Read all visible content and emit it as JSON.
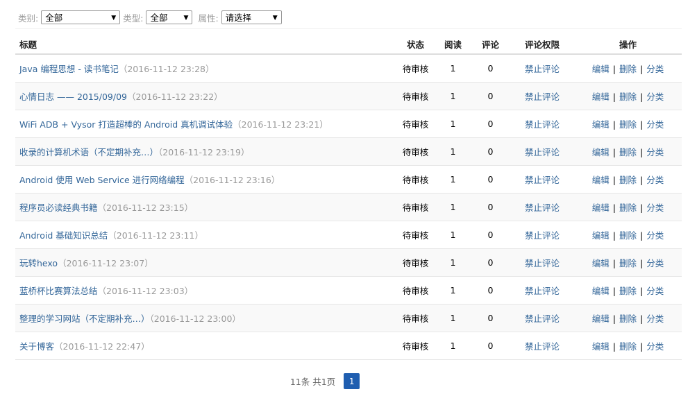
{
  "filters": {
    "category_label": "类别:",
    "category_value": "全部",
    "type_label": "类型:",
    "type_value": "全部",
    "attr_label": "属性:",
    "attr_value": "请选择"
  },
  "table": {
    "headers": {
      "title": "标题",
      "status": "状态",
      "reads": "阅读",
      "comments": "评论",
      "permission": "评论权限",
      "actions": "操作"
    },
    "rows": [
      {
        "title": "Java 编程思想 - 读书笔记",
        "date": "（2016-11-12 23:28）",
        "status": "待审核",
        "reads": "1",
        "comments": "0",
        "permission": "禁止评论"
      },
      {
        "title": "心情日志 —— 2015/09/09",
        "date": "（2016-11-12 23:22）",
        "status": "待审核",
        "reads": "1",
        "comments": "0",
        "permission": "禁止评论"
      },
      {
        "title": "WiFi ADB + Vysor 打造超棒的 Android 真机调试体验",
        "date": "（2016-11-12 23:21）",
        "status": "待审核",
        "reads": "1",
        "comments": "0",
        "permission": "禁止评论"
      },
      {
        "title": "收录的计算机术语（不定期补充…）",
        "date": "（2016-11-12 23:19）",
        "status": "待审核",
        "reads": "1",
        "comments": "0",
        "permission": "禁止评论"
      },
      {
        "title": "Android 使用 Web Service 进行网络编程",
        "date": "（2016-11-12 23:16）",
        "status": "待审核",
        "reads": "1",
        "comments": "0",
        "permission": "禁止评论"
      },
      {
        "title": "程序员必读经典书籍",
        "date": "（2016-11-12 23:15）",
        "status": "待审核",
        "reads": "1",
        "comments": "0",
        "permission": "禁止评论"
      },
      {
        "title": "Android 基础知识总结",
        "date": "（2016-11-12 23:11）",
        "status": "待审核",
        "reads": "1",
        "comments": "0",
        "permission": "禁止评论"
      },
      {
        "title": "玩转hexo",
        "date": "（2016-11-12 23:07）",
        "status": "待审核",
        "reads": "1",
        "comments": "0",
        "permission": "禁止评论"
      },
      {
        "title": "蓝桥杯比赛算法总结",
        "date": "（2016-11-12 23:03）",
        "status": "待审核",
        "reads": "1",
        "comments": "0",
        "permission": "禁止评论"
      },
      {
        "title": "整理的学习网站（不定期补充…）",
        "date": "（2016-11-12 23:00）",
        "status": "待审核",
        "reads": "1",
        "comments": "0",
        "permission": "禁止评论"
      },
      {
        "title": "关于博客",
        "date": "（2016-11-12 22:47）",
        "status": "待审核",
        "reads": "1",
        "comments": "0",
        "permission": "禁止评论"
      }
    ],
    "actions": {
      "edit": "编辑",
      "delete": "删除",
      "category": "分类",
      "separator": "|"
    }
  },
  "pagination": {
    "info": "11条 共1页",
    "current_page": "1"
  },
  "colors": {
    "link": "#336699",
    "date": "#999999",
    "page_active": "#1f5eb0"
  }
}
